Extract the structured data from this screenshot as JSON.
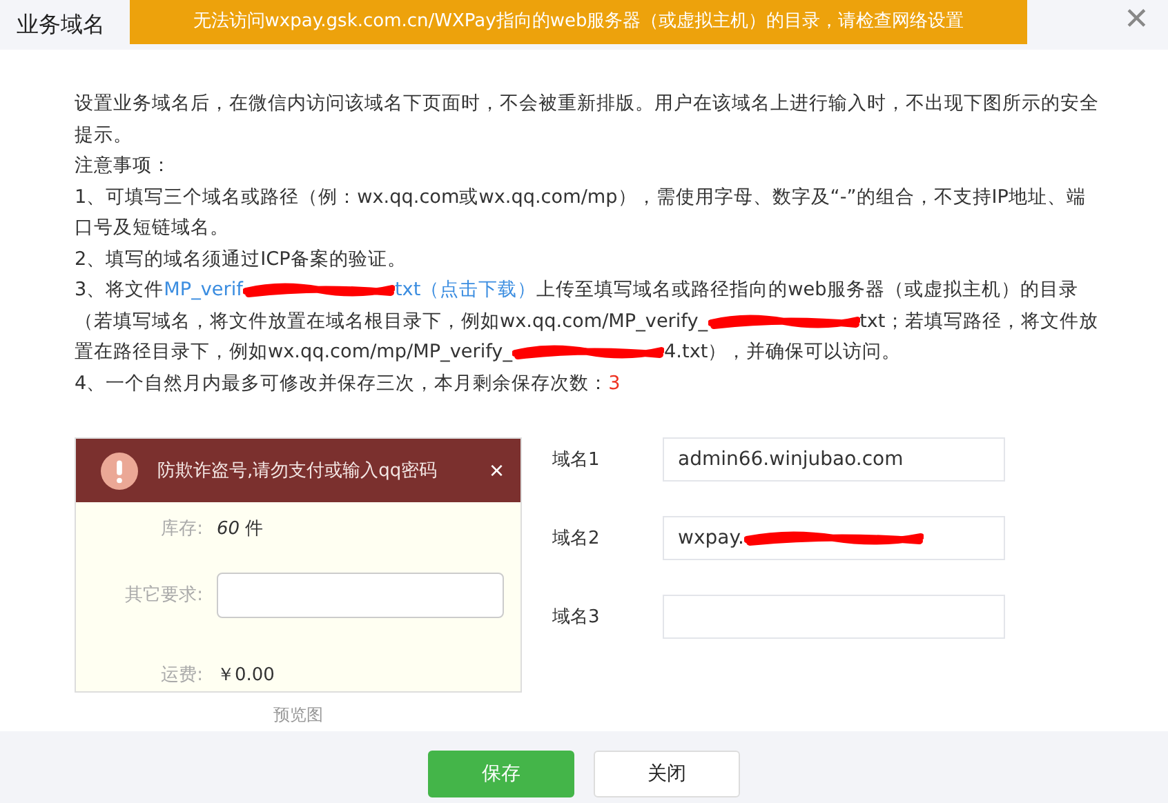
{
  "header": {
    "tab": "业务域名",
    "error_banner": "无法访问wxpay.gsk.com.cn/WXPay指向的web服务器（或虚拟主机）的目录，请检查网络设置",
    "close": "✕"
  },
  "intro": "设置业务域名后，在微信内访问该域名下页面时，不会被重新排版。用户在该域名上进行输入时，不出现下图所示的安全提示。",
  "notes_title": "注意事项：",
  "notes": [
    [
      {
        "kind": "text",
        "text": "1、可填写三个域名或路径（例：wx.qq.com或wx.qq.com/mp），需使用字母、数字及“-”的组合，不支持IP地址、端口号及短链域名。"
      }
    ],
    [
      {
        "kind": "text",
        "text": "2、填写的域名须通过ICP备案的验证。"
      }
    ],
    [
      {
        "kind": "text",
        "text": "3、将文件"
      },
      {
        "kind": "link",
        "text": "MP_verif"
      },
      {
        "kind": "redacted"
      },
      {
        "kind": "link",
        "text": "txt（点击下载）"
      },
      {
        "kind": "text",
        "text": "上传至填写域名或路径指向的web服务器（或虚拟主机）的目录（若填写域名，将文件放置在域名根目录下，例如wx.qq.com/MP_verify_"
      },
      {
        "kind": "redacted"
      },
      {
        "kind": "text",
        "text": "txt；若填写路径，将文件放置在路径目录下，例如wx.qq.com/mp/MP_verify_"
      },
      {
        "kind": "redacted"
      },
      {
        "kind": "text",
        "text": "4.txt），并确保可以访问。"
      }
    ],
    [
      {
        "kind": "text",
        "text": "4、一个自然月内最多可修改并保存三次，本月剩余保存次数："
      },
      {
        "kind": "count",
        "text": "3"
      }
    ]
  ],
  "preview": {
    "toast": "防欺诈盗号,请勿支付或输入qq密码",
    "toast_close": "×",
    "rows": [
      {
        "kind": "value",
        "label": "库存:",
        "value": "60",
        "unit": "件"
      },
      {
        "kind": "input",
        "label": "其它要求:"
      },
      {
        "kind": "value",
        "label": "运费:",
        "value": "￥0.00"
      }
    ],
    "caption": "预览图"
  },
  "domains": [
    {
      "label": "域名1",
      "value": "admin66.winjubao.com",
      "redacted": false
    },
    {
      "label": "域名2",
      "value": "wxpay.",
      "redacted": true
    },
    {
      "label": "域名3",
      "redacted": false
    }
  ],
  "buttons": [
    {
      "label": "保存",
      "kind": "primary"
    },
    {
      "label": "关闭",
      "kind": "default"
    }
  ]
}
